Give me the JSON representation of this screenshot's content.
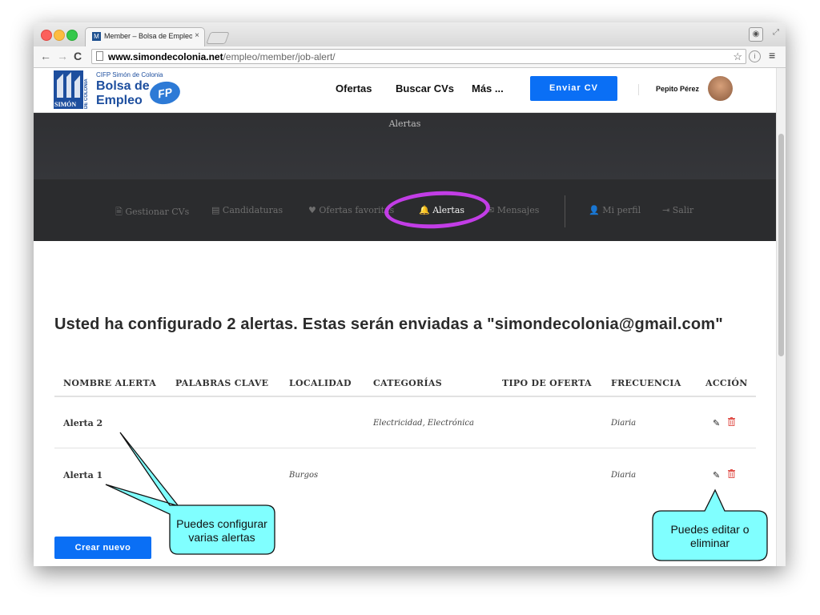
{
  "browser": {
    "tab_title": "Member – Bolsa de Empleo",
    "tab_close": "×",
    "url_host": "www.simondecolonia.net",
    "url_path": "/empleo/member/job-alert/",
    "back": "←",
    "forward": "→",
    "reload": "C",
    "star": "☆",
    "menu": "≡"
  },
  "header": {
    "logo": {
      "subtitle": "CIFP Simón de Colonia",
      "title_line1": "Bolsa de",
      "title_line2": "Empleo",
      "mark_text": "SIMÓN",
      "side_text": "DE COLONIA",
      "fp": "FP"
    },
    "nav": [
      "Ofertas",
      "Buscar CVs",
      "Más ..."
    ],
    "cta_label": "Enviar CV",
    "user_name": "Pepito Pérez"
  },
  "hero": {
    "title": "Alertas"
  },
  "subnav": [
    {
      "icon": "🗎",
      "label": "Gestionar CVs"
    },
    {
      "icon": "▤",
      "label": "Candidaturas"
    },
    {
      "icon": "♥",
      "label": "Ofertas favoritas"
    },
    {
      "icon": "🔔",
      "label": "Alertas"
    },
    {
      "icon": "✉",
      "label": "Mensajes"
    },
    {
      "icon": "👤",
      "label": "Mi perfil"
    },
    {
      "icon": "⇥",
      "label": "Salir"
    }
  ],
  "main": {
    "heading": "Usted ha configurado 2 alertas. Estas serán enviadas a \"simondecolonia@gmail.com\"",
    "table": {
      "columns": [
        "NOMBRE ALERTA",
        "PALABRAS CLAVE",
        "LOCALIDAD",
        "CATEGORÍAS",
        "TIPO DE OFERTA",
        "FRECUENCIA",
        "ACCIÓN"
      ],
      "rows": [
        {
          "name": "Alerta 2",
          "keywords": "",
          "location": "",
          "categories": "Electricidad, Electrónica",
          "type": "",
          "frequency": "Diaria"
        },
        {
          "name": "Alerta 1",
          "keywords": "",
          "location": "Burgos",
          "categories": "",
          "type": "",
          "frequency": "Diaria"
        }
      ]
    },
    "create_button": "Crear nuevo"
  },
  "callouts": {
    "left_line1": "Puedes configurar",
    "left_line2": "varias alertas",
    "right_line1": "Puedes editar o",
    "right_line2": "eliminar"
  },
  "colors": {
    "accent": "#0a6ff5",
    "highlight": "#c23de6",
    "callout_fill": "#80ffff",
    "delete": "#e0504a"
  }
}
